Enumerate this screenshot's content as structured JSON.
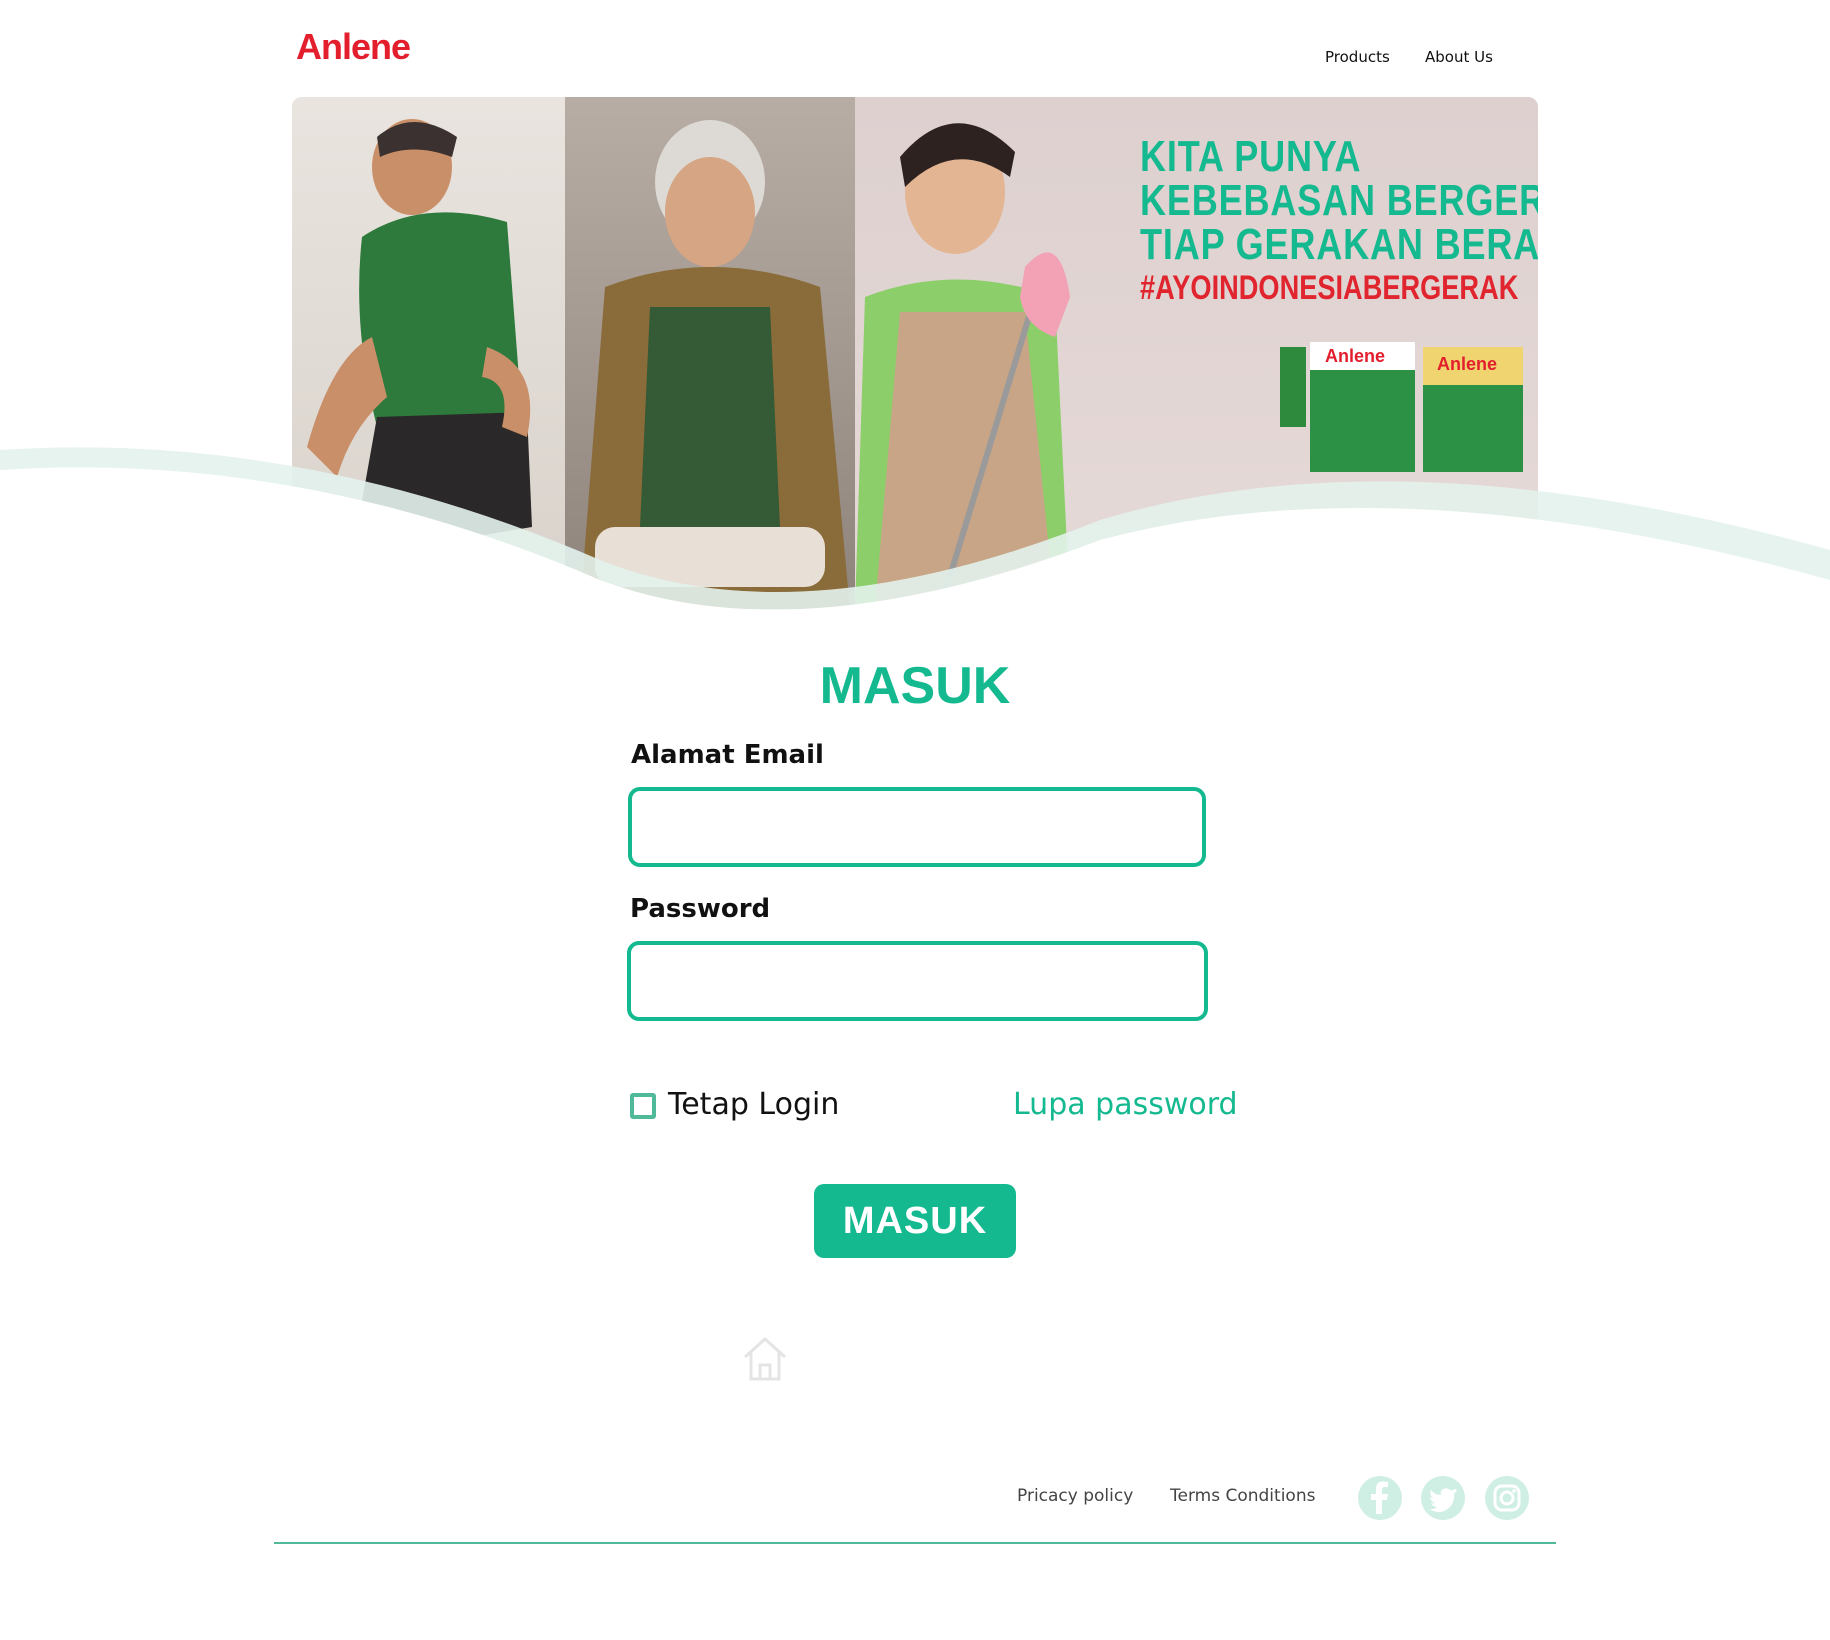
{
  "header": {
    "logo": "Anlene",
    "nav": [
      "Products",
      "About Us"
    ]
  },
  "banner": {
    "headline": [
      "KITA PUNYA",
      "KEBEBASAN BERGERAK",
      "TIAP GERAKAN BERARTI"
    ],
    "hashtag": "#AYOINDONESIABERGERAK",
    "product_brand": "Anlene"
  },
  "login": {
    "title": "MASUK",
    "email_label": "Alamat Email",
    "email_value": "",
    "password_label": "Password",
    "password_value": "",
    "remember_label": "Tetap Login",
    "remember_checked": false,
    "forgot_label": "Lupa password",
    "submit_label": "MASUK"
  },
  "footer": {
    "privacy": "Pricacy policy",
    "terms": "Terms Conditions",
    "social_icons": [
      "facebook-icon",
      "twitter-icon",
      "instagram-icon"
    ]
  },
  "colors": {
    "brand_red": "#e31e2d",
    "accent_green": "#14b98f",
    "social_bg": "#cfeee4"
  }
}
